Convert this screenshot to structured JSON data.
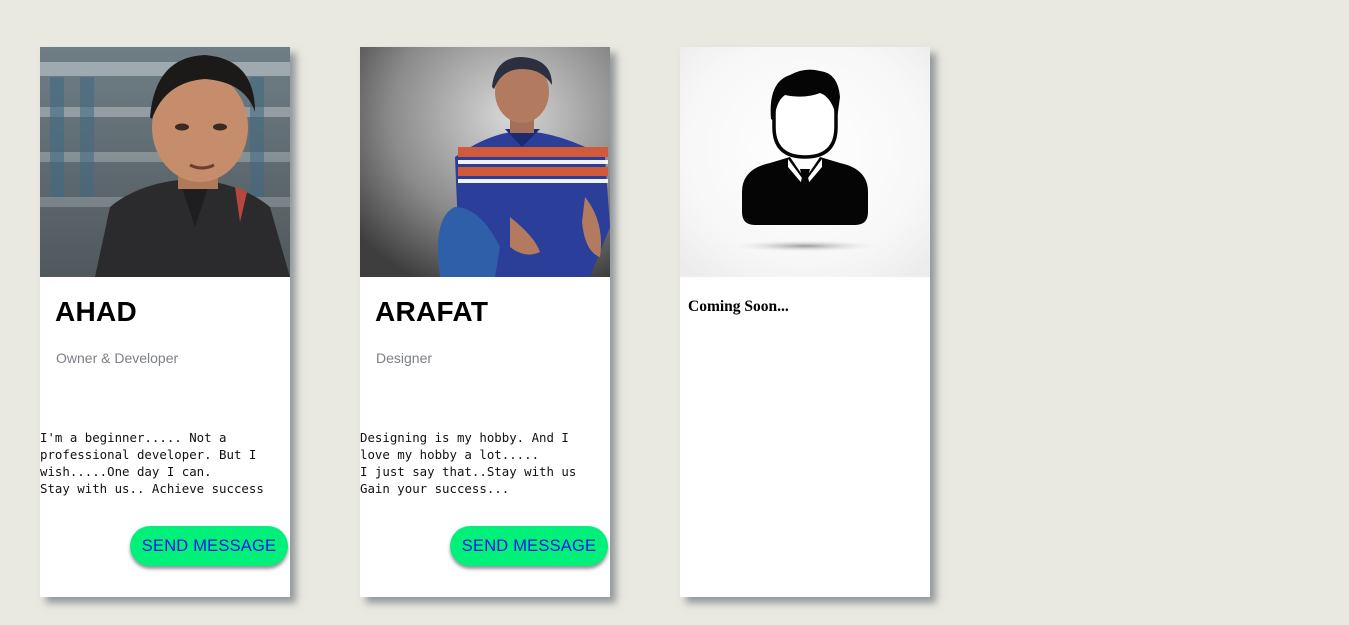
{
  "cards": [
    {
      "name": "AHAD",
      "role": "Owner & Developer",
      "bio": "I'm a beginner..... Not a\nprofessional developer. But I\nwish.....One day I can.\nStay with us.. Achieve success",
      "button_label": "SEND MESSAGE"
    },
    {
      "name": "ARAFAT",
      "role": "Designer",
      "bio": "Designing is my hobby. And I\nlove my hobby a lot.....\nI just say that..Stay with us\nGain your success...",
      "button_label": "SEND MESSAGE"
    },
    {
      "coming_soon": "Coming Soon..."
    }
  ],
  "colors": {
    "page_background": "#e9e8e1",
    "card_background": "#ffffff",
    "button_background": "#00f07a",
    "button_text": "#1515e8",
    "role_text": "#7b7f86"
  }
}
